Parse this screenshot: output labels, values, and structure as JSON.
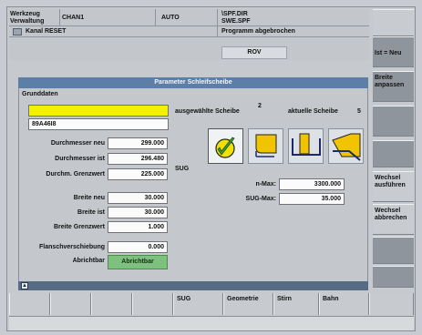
{
  "header": {
    "area_line1": "Werkzeug",
    "area_line2": "Verwaltung",
    "channel": "CHAN1",
    "mode": "AUTO",
    "path1": "\\SPF.DIR",
    "path2": "SWE.SPF",
    "channel_status": "Kanal RESET",
    "program_status": "Programm abgebrochen",
    "rov": "ROV"
  },
  "right_softkeys": [
    "",
    "Ist = Neu",
    "Breite anpassen",
    "",
    "",
    "Wechsel ausführen",
    "Wechsel abbrechen",
    "",
    ""
  ],
  "dialog": {
    "title": "Parameter Schleifscheibe",
    "section": "Grunddaten",
    "field_top": "",
    "field_id": "89A46I8",
    "rows": [
      {
        "label": "Durchmesser neu",
        "value": "299.000"
      },
      {
        "label": "Durchmesser ist",
        "value": "296.480"
      },
      {
        "label": "Durchm. Grenzwert",
        "value": "225.000"
      },
      {
        "label": "Breite neu",
        "value": "30.000"
      },
      {
        "label": "Breite ist",
        "value": "30.000"
      },
      {
        "label": "Breite Grenzwert",
        "value": "1.000"
      },
      {
        "label": "Flanschverschiebung",
        "value": "0.000"
      }
    ],
    "abrichtbar_label": "Abrichtbar",
    "abrichtbar_value": "Abrichtbar",
    "selected_wheel_label": "ausgewählte Scheibe",
    "selected_wheel_value": "2",
    "current_wheel_label": "aktuelle Scheibe",
    "current_wheel_value": "5",
    "sug_label": "SUG",
    "nmax_label": "n-Max:",
    "nmax_value": "3300.000",
    "sugmax_label": "SUG-Max:",
    "sugmax_value": "35.000",
    "icons": [
      "wheel-edit-icon",
      "wheel-profile-1-icon",
      "wheel-profile-2-icon",
      "wheel-profile-3-icon"
    ]
  },
  "bottom_softkeys": [
    "",
    "",
    "",
    "",
    "SUG",
    "Geometrie",
    "Stirn",
    "Bahn",
    "",
    ""
  ],
  "colors": {
    "title_bar": "#5b7fa6",
    "highlight_field": "#f3f100",
    "green_button": "#7ec07e"
  }
}
